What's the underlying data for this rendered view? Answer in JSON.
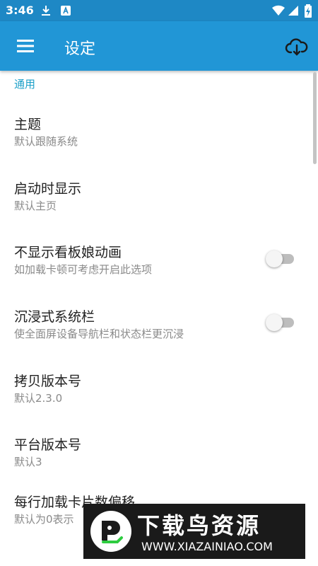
{
  "status_bar": {
    "time": "3:46",
    "icons": [
      "download-icon",
      "app-notification-icon",
      "wifi-icon",
      "signal-icon",
      "battery-charging-icon"
    ],
    "color": "#1e88c5"
  },
  "toolbar": {
    "title": "设定",
    "color": "#2196d6",
    "menu_icon": "hamburger-menu-icon",
    "action_icon": "cloud-download-icon"
  },
  "section": {
    "header": "通用",
    "accent": "#1ca0c8"
  },
  "preferences": [
    {
      "title": "主题",
      "summary": "默认跟随系统"
    },
    {
      "title": "启动时显示",
      "summary": "默认主页"
    },
    {
      "title": "不显示看板娘动画",
      "summary": "如加载卡顿可考虑开启此选项",
      "switch_on": false
    },
    {
      "title": "沉浸式系统栏",
      "summary": "使全面屏设备导航栏和状态栏更沉浸",
      "switch_on": false
    },
    {
      "title": "拷贝版本号",
      "summary": "默认2.3.0"
    },
    {
      "title": "平台版本号",
      "summary": "默认3"
    },
    {
      "title": "每行加载卡片数偏移",
      "summary": "默认为0表示"
    }
  ],
  "watermark": {
    "title": "下载鸟资源",
    "url": "WWW.XIAZAINIAO.COM"
  }
}
